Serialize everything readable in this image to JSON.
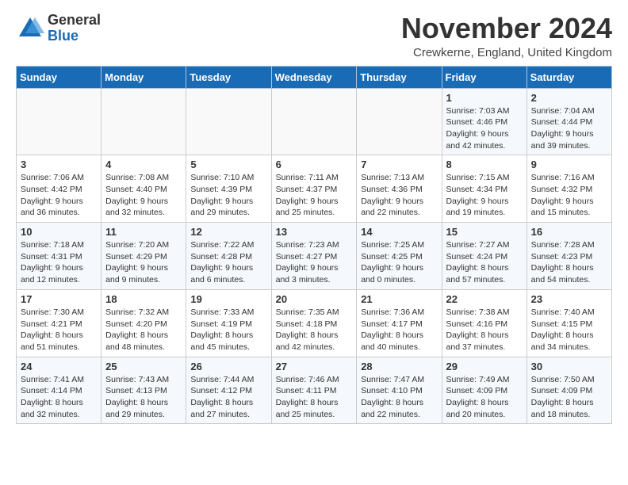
{
  "logo": {
    "general": "General",
    "blue": "Blue"
  },
  "title": "November 2024",
  "subtitle": "Crewkerne, England, United Kingdom",
  "days_of_week": [
    "Sunday",
    "Monday",
    "Tuesday",
    "Wednesday",
    "Thursday",
    "Friday",
    "Saturday"
  ],
  "weeks": [
    [
      {
        "day": "",
        "info": ""
      },
      {
        "day": "",
        "info": ""
      },
      {
        "day": "",
        "info": ""
      },
      {
        "day": "",
        "info": ""
      },
      {
        "day": "",
        "info": ""
      },
      {
        "day": "1",
        "info": "Sunrise: 7:03 AM\nSunset: 4:46 PM\nDaylight: 9 hours\nand 42 minutes."
      },
      {
        "day": "2",
        "info": "Sunrise: 7:04 AM\nSunset: 4:44 PM\nDaylight: 9 hours\nand 39 minutes."
      }
    ],
    [
      {
        "day": "3",
        "info": "Sunrise: 7:06 AM\nSunset: 4:42 PM\nDaylight: 9 hours\nand 36 minutes."
      },
      {
        "day": "4",
        "info": "Sunrise: 7:08 AM\nSunset: 4:40 PM\nDaylight: 9 hours\nand 32 minutes."
      },
      {
        "day": "5",
        "info": "Sunrise: 7:10 AM\nSunset: 4:39 PM\nDaylight: 9 hours\nand 29 minutes."
      },
      {
        "day": "6",
        "info": "Sunrise: 7:11 AM\nSunset: 4:37 PM\nDaylight: 9 hours\nand 25 minutes."
      },
      {
        "day": "7",
        "info": "Sunrise: 7:13 AM\nSunset: 4:36 PM\nDaylight: 9 hours\nand 22 minutes."
      },
      {
        "day": "8",
        "info": "Sunrise: 7:15 AM\nSunset: 4:34 PM\nDaylight: 9 hours\nand 19 minutes."
      },
      {
        "day": "9",
        "info": "Sunrise: 7:16 AM\nSunset: 4:32 PM\nDaylight: 9 hours\nand 15 minutes."
      }
    ],
    [
      {
        "day": "10",
        "info": "Sunrise: 7:18 AM\nSunset: 4:31 PM\nDaylight: 9 hours\nand 12 minutes."
      },
      {
        "day": "11",
        "info": "Sunrise: 7:20 AM\nSunset: 4:29 PM\nDaylight: 9 hours\nand 9 minutes."
      },
      {
        "day": "12",
        "info": "Sunrise: 7:22 AM\nSunset: 4:28 PM\nDaylight: 9 hours\nand 6 minutes."
      },
      {
        "day": "13",
        "info": "Sunrise: 7:23 AM\nSunset: 4:27 PM\nDaylight: 9 hours\nand 3 minutes."
      },
      {
        "day": "14",
        "info": "Sunrise: 7:25 AM\nSunset: 4:25 PM\nDaylight: 9 hours\nand 0 minutes."
      },
      {
        "day": "15",
        "info": "Sunrise: 7:27 AM\nSunset: 4:24 PM\nDaylight: 8 hours\nand 57 minutes."
      },
      {
        "day": "16",
        "info": "Sunrise: 7:28 AM\nSunset: 4:23 PM\nDaylight: 8 hours\nand 54 minutes."
      }
    ],
    [
      {
        "day": "17",
        "info": "Sunrise: 7:30 AM\nSunset: 4:21 PM\nDaylight: 8 hours\nand 51 minutes."
      },
      {
        "day": "18",
        "info": "Sunrise: 7:32 AM\nSunset: 4:20 PM\nDaylight: 8 hours\nand 48 minutes."
      },
      {
        "day": "19",
        "info": "Sunrise: 7:33 AM\nSunset: 4:19 PM\nDaylight: 8 hours\nand 45 minutes."
      },
      {
        "day": "20",
        "info": "Sunrise: 7:35 AM\nSunset: 4:18 PM\nDaylight: 8 hours\nand 42 minutes."
      },
      {
        "day": "21",
        "info": "Sunrise: 7:36 AM\nSunset: 4:17 PM\nDaylight: 8 hours\nand 40 minutes."
      },
      {
        "day": "22",
        "info": "Sunrise: 7:38 AM\nSunset: 4:16 PM\nDaylight: 8 hours\nand 37 minutes."
      },
      {
        "day": "23",
        "info": "Sunrise: 7:40 AM\nSunset: 4:15 PM\nDaylight: 8 hours\nand 34 minutes."
      }
    ],
    [
      {
        "day": "24",
        "info": "Sunrise: 7:41 AM\nSunset: 4:14 PM\nDaylight: 8 hours\nand 32 minutes."
      },
      {
        "day": "25",
        "info": "Sunrise: 7:43 AM\nSunset: 4:13 PM\nDaylight: 8 hours\nand 29 minutes."
      },
      {
        "day": "26",
        "info": "Sunrise: 7:44 AM\nSunset: 4:12 PM\nDaylight: 8 hours\nand 27 minutes."
      },
      {
        "day": "27",
        "info": "Sunrise: 7:46 AM\nSunset: 4:11 PM\nDaylight: 8 hours\nand 25 minutes."
      },
      {
        "day": "28",
        "info": "Sunrise: 7:47 AM\nSunset: 4:10 PM\nDaylight: 8 hours\nand 22 minutes."
      },
      {
        "day": "29",
        "info": "Sunrise: 7:49 AM\nSunset: 4:09 PM\nDaylight: 8 hours\nand 20 minutes."
      },
      {
        "day": "30",
        "info": "Sunrise: 7:50 AM\nSunset: 4:09 PM\nDaylight: 8 hours\nand 18 minutes."
      }
    ]
  ]
}
